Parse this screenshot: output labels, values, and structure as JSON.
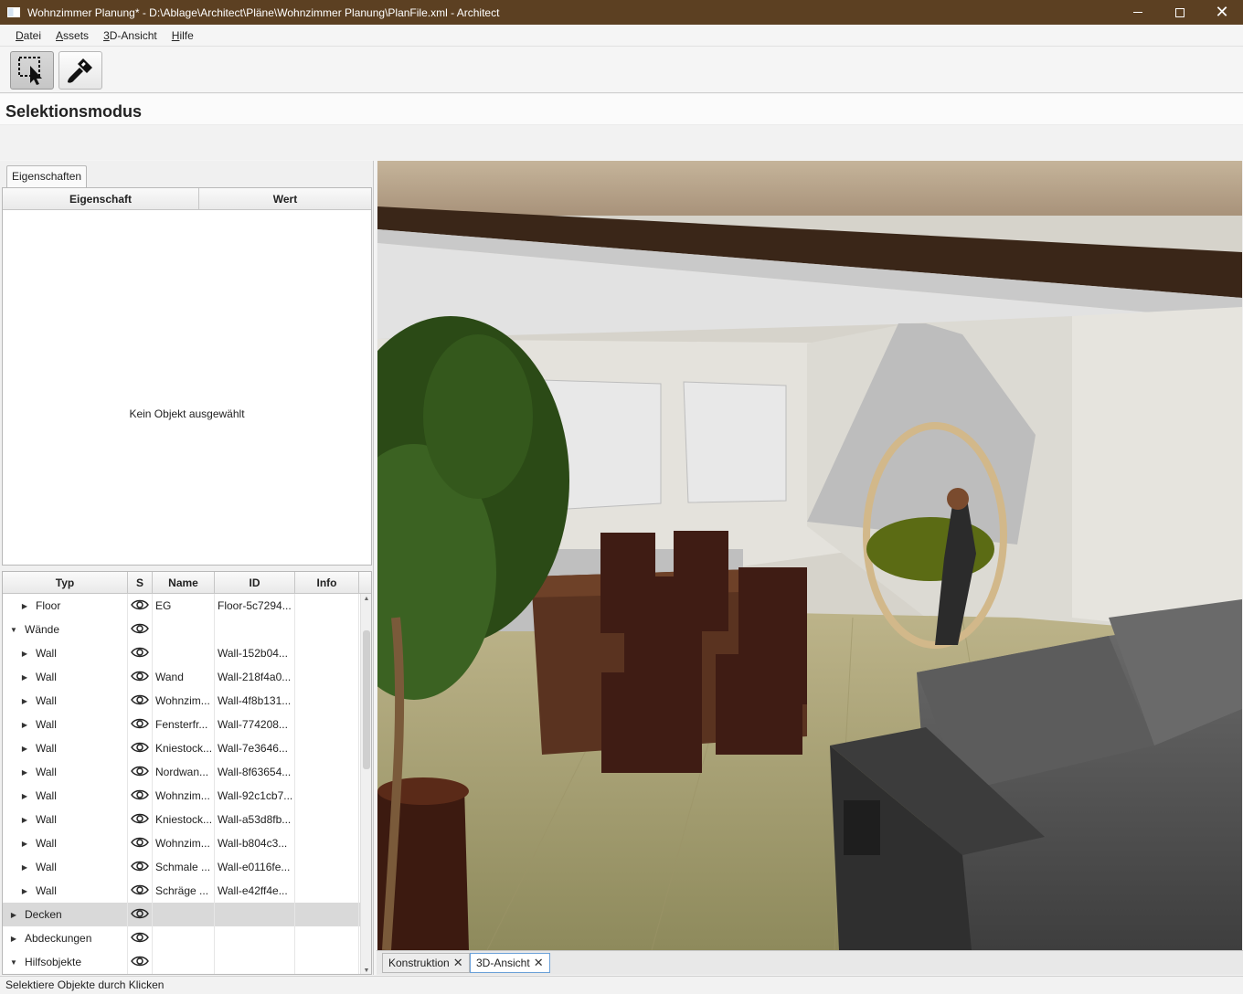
{
  "window": {
    "title": "Wohnzimmer Planung* - D:\\Ablage\\Architect\\Pläne\\Wohnzimmer Planung\\PlanFile.xml - Architect",
    "close_glyph": "✕"
  },
  "menu": [
    "Datei",
    "Assets",
    "3D-Ansicht",
    "Hilfe"
  ],
  "toolbar": {
    "tools": [
      {
        "icon": "selection-arrow-icon",
        "active": true
      },
      {
        "icon": "paint-brush-icon",
        "active": false
      }
    ]
  },
  "mode": {
    "title": "Selektionsmodus"
  },
  "properties": {
    "tab_label": "Eigenschaften",
    "columns": [
      "Eigenschaft",
      "Wert"
    ],
    "empty_text": "Kein Objekt ausgewählt"
  },
  "tree": {
    "columns": [
      "Typ",
      "S",
      "Name",
      "ID",
      "Info"
    ],
    "rows": [
      {
        "indent": 1,
        "arrow": "▶",
        "typ": "Floor",
        "name": "EG",
        "id": "Floor-5c7294...",
        "info": ""
      },
      {
        "indent": 0,
        "arrow": "▼",
        "typ": "Wände",
        "name": "",
        "id": "",
        "info": ""
      },
      {
        "indent": 1,
        "arrow": "▶",
        "typ": "Wall",
        "name": "",
        "id": "Wall-152b04...",
        "info": ""
      },
      {
        "indent": 1,
        "arrow": "▶",
        "typ": "Wall",
        "name": "Wand",
        "id": "Wall-218f4a0...",
        "info": ""
      },
      {
        "indent": 1,
        "arrow": "▶",
        "typ": "Wall",
        "name": "Wohnzim...",
        "id": "Wall-4f8b131...",
        "info": ""
      },
      {
        "indent": 1,
        "arrow": "▶",
        "typ": "Wall",
        "name": "Fensterfr...",
        "id": "Wall-774208...",
        "info": ""
      },
      {
        "indent": 1,
        "arrow": "▶",
        "typ": "Wall",
        "name": "Kniestock...",
        "id": "Wall-7e3646...",
        "info": ""
      },
      {
        "indent": 1,
        "arrow": "▶",
        "typ": "Wall",
        "name": "Nordwan...",
        "id": "Wall-8f63654...",
        "info": ""
      },
      {
        "indent": 1,
        "arrow": "▶",
        "typ": "Wall",
        "name": "Wohnzim...",
        "id": "Wall-92c1cb7...",
        "info": ""
      },
      {
        "indent": 1,
        "arrow": "▶",
        "typ": "Wall",
        "name": "Kniestock...",
        "id": "Wall-a53d8fb...",
        "info": ""
      },
      {
        "indent": 1,
        "arrow": "▶",
        "typ": "Wall",
        "name": "Wohnzim...",
        "id": "Wall-b804c3...",
        "info": ""
      },
      {
        "indent": 1,
        "arrow": "▶",
        "typ": "Wall",
        "name": "Schmale ...",
        "id": "Wall-e0116fe...",
        "info": ""
      },
      {
        "indent": 1,
        "arrow": "▶",
        "typ": "Wall",
        "name": "Schräge ...",
        "id": "Wall-e42ff4e...",
        "info": ""
      },
      {
        "indent": 0,
        "arrow": "▶",
        "typ": "Decken",
        "name": "",
        "id": "",
        "info": "",
        "selected": true
      },
      {
        "indent": 0,
        "arrow": "▶",
        "typ": "Abdeckungen",
        "name": "",
        "id": "",
        "info": ""
      },
      {
        "indent": 0,
        "arrow": "▼",
        "typ": "Hilfsobjekte",
        "name": "",
        "id": "",
        "info": ""
      }
    ]
  },
  "view_tabs": [
    {
      "label": "Konstruktion",
      "active": false
    },
    {
      "label": "3D-Ansicht",
      "active": true
    }
  ],
  "status": {
    "text": "Selektiere Objekte durch Klicken"
  }
}
